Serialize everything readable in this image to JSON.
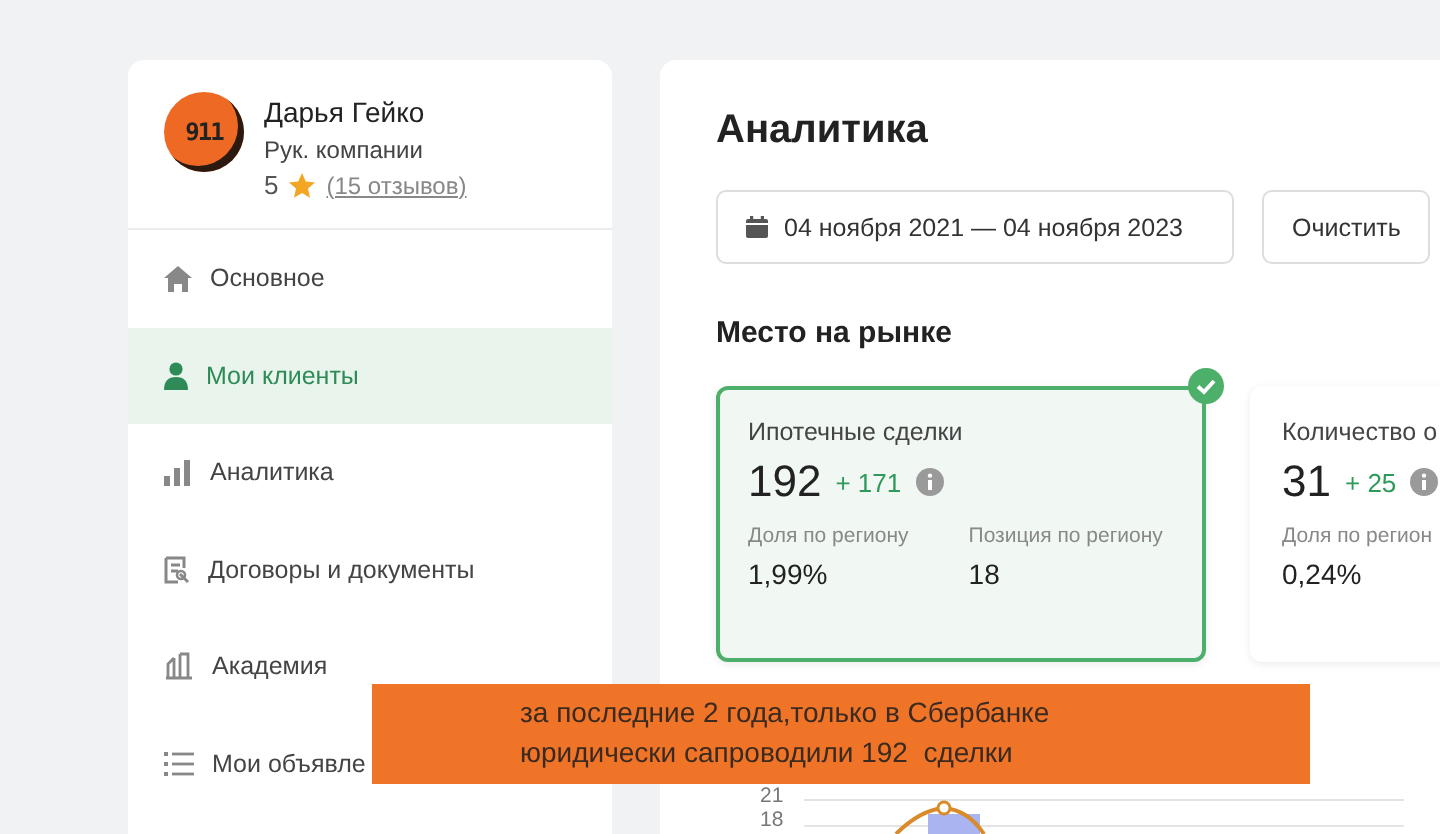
{
  "profile": {
    "logo_text": "911",
    "name": "Дарья Гейко",
    "role": "Рук. компании",
    "rating": "5",
    "reviews": "(15 отзывов)"
  },
  "menu": [
    {
      "label": "Основное",
      "kind": "home",
      "selected": false
    },
    {
      "label": "Мои клиенты",
      "kind": "user",
      "selected": true
    },
    {
      "label": "Аналитика",
      "kind": "bars",
      "selected": false
    },
    {
      "label": "Договоры и документы",
      "kind": "doc",
      "selected": false
    },
    {
      "label": "Академия",
      "kind": "academy",
      "selected": false
    },
    {
      "label": "Мои объявле",
      "kind": "list",
      "selected": false
    }
  ],
  "page": {
    "title": "Аналитика",
    "date_range": "04 ноября 2021 — 04 ноября 2023",
    "clear_button": "Очистить",
    "section_title": "Место на рынке"
  },
  "metrics": [
    {
      "title": "Ипотечные сделки",
      "value": "192",
      "delta": "+ 171",
      "selected": true,
      "stats": [
        {
          "label": "Доля по региону",
          "value": "1,99%"
        },
        {
          "label": "Позиция по региону",
          "value": "18"
        }
      ]
    },
    {
      "title": "Количество о",
      "value": "31",
      "delta": "+ 25",
      "selected": false,
      "stats": [
        {
          "label": "Доля по регион",
          "value": "0,24%"
        }
      ]
    }
  ],
  "chart": {
    "tick_labels": [
      "21",
      "18"
    ]
  },
  "banner": {
    "lines": [
      "за последние 2 года,только в Сбербанке",
      "юридически сапроводили 192  сделки"
    ]
  }
}
